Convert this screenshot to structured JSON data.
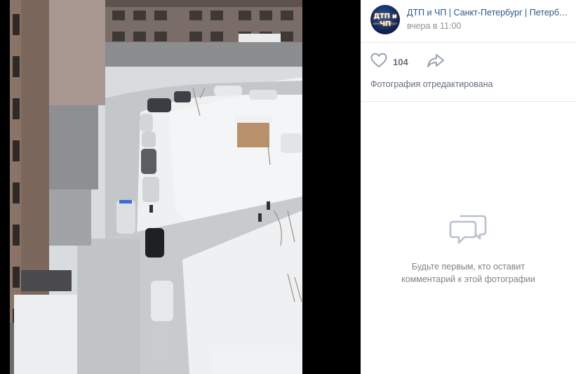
{
  "post": {
    "group_name": "ДТП и ЧП | Санкт-Петербург | Петербург",
    "time": "вчера в 11:00",
    "likes": "104",
    "edited_note": "Фотография отредактирована",
    "avatar_text": "ДТП и ЧП",
    "avatar_subtext": "санкт-петербург"
  },
  "comments": {
    "empty_line1": "Будьте первым, кто оставит",
    "empty_line2": "комментарий к этой фотографии"
  },
  "icons": {
    "like": "heart-outline-icon",
    "share": "share-arrow-icon",
    "comments_empty": "speech-bubbles-icon"
  },
  "colors": {
    "link": "#2a5885",
    "muted": "#939393",
    "text_secondary": "#626d7a",
    "icon": "#99a2ad",
    "background_photo": "#000000"
  }
}
